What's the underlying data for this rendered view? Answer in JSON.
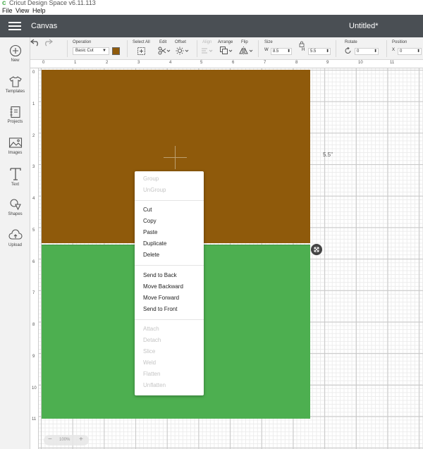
{
  "app": {
    "title": "Cricut Design Space  v6.11.113"
  },
  "menubar": {
    "file": "File",
    "view": "View",
    "help": "Help"
  },
  "header": {
    "section": "Canvas",
    "doc_title": "Untitled*"
  },
  "toolbar": {
    "operation_label": "Operation",
    "operation_value": "Basic Cut",
    "operation_color": "#8f5a0b",
    "select_all_label": "Select All",
    "edit_label": "Edit",
    "offset_label": "Offset",
    "align_label": "Align",
    "arrange_label": "Arrange",
    "flip_label": "Flip",
    "size_label": "Size",
    "w_label": "W",
    "w_value": "8.5",
    "h_label": "H",
    "h_value": "5.5",
    "rotate_label": "Rotate",
    "rotate_value": "0",
    "position_label": "Position",
    "x_label": "X",
    "x_value": "0"
  },
  "sidebar": {
    "items": [
      {
        "label": "New",
        "icon": "plus-circle-icon"
      },
      {
        "label": "Templates",
        "icon": "tshirt-icon"
      },
      {
        "label": "Projects",
        "icon": "notebook-icon"
      },
      {
        "label": "Images",
        "icon": "image-icon"
      },
      {
        "label": "Text",
        "icon": "text-t-icon"
      },
      {
        "label": "Shapes",
        "icon": "shapes-icon"
      },
      {
        "label": "Upload",
        "icon": "cloud-upload-icon"
      }
    ]
  },
  "ruler": {
    "h": [
      "0",
      "1",
      "2",
      "3",
      "4",
      "5",
      "6",
      "7",
      "8",
      "9",
      "10",
      "11"
    ],
    "v": [
      "0",
      "1",
      "2",
      "3",
      "4",
      "5",
      "6",
      "7",
      "8",
      "9",
      "10",
      "11"
    ]
  },
  "canvas": {
    "size_label": "5.5\"",
    "zoom_value": "100%",
    "zoom_minus": "−",
    "zoom_plus": "+",
    "top_shape_color": "#8f5a0b",
    "bottom_shape_color": "#4daf50"
  },
  "context_menu": {
    "group": "Group",
    "ungroup": "UnGroup",
    "cut": "Cut",
    "copy": "Copy",
    "paste": "Paste",
    "duplicate": "Duplicate",
    "delete": "Delete",
    "send_to_back": "Send to Back",
    "move_backward": "Move Backward",
    "move_forward": "Move Forward",
    "send_to_front": "Send to Front",
    "attach": "Attach",
    "detach": "Detach",
    "slice": "Slice",
    "weld": "Weld",
    "flatten": "Flatten",
    "unflatten": "Unflatten"
  }
}
